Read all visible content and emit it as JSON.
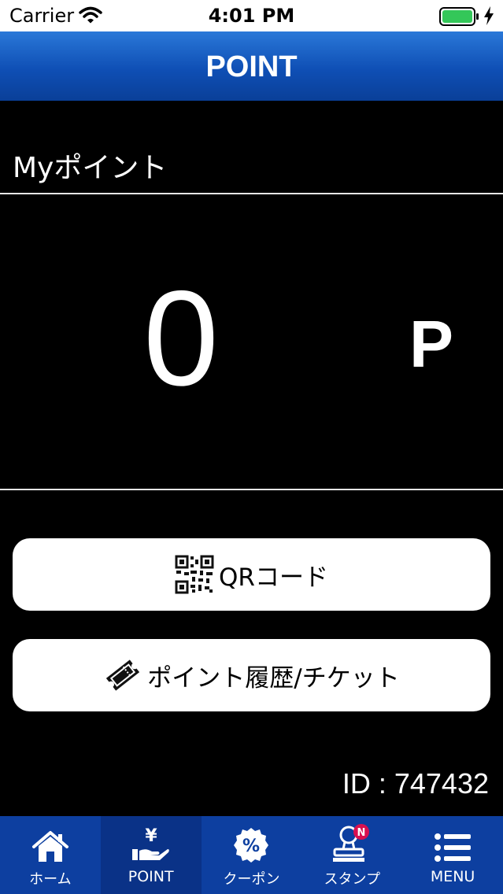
{
  "status_bar": {
    "carrier": "Carrier",
    "time": "4:01 PM"
  },
  "nav": {
    "title": "POINT"
  },
  "section": {
    "title": "Myポイント"
  },
  "points": {
    "value": "0",
    "unit": "P"
  },
  "buttons": {
    "qr_label": "QRコード",
    "history_label": "ポイント履歴/チケット"
  },
  "user": {
    "id_text": "ID : 747432"
  },
  "tabs": [
    {
      "label": "ホーム",
      "icon": "home-icon"
    },
    {
      "label": "POINT",
      "icon": "yen-hand-icon"
    },
    {
      "label": "クーポン",
      "icon": "percent-badge-icon"
    },
    {
      "label": "スタンプ",
      "icon": "stamp-icon",
      "badge": "N"
    },
    {
      "label": "MENU",
      "icon": "list-menu-icon"
    }
  ],
  "colors": {
    "nav_blue": "#0f4fb5",
    "tab_bar_blue": "#0d3fa0",
    "badge_red": "#d8104f",
    "battery_green": "#34c759"
  }
}
